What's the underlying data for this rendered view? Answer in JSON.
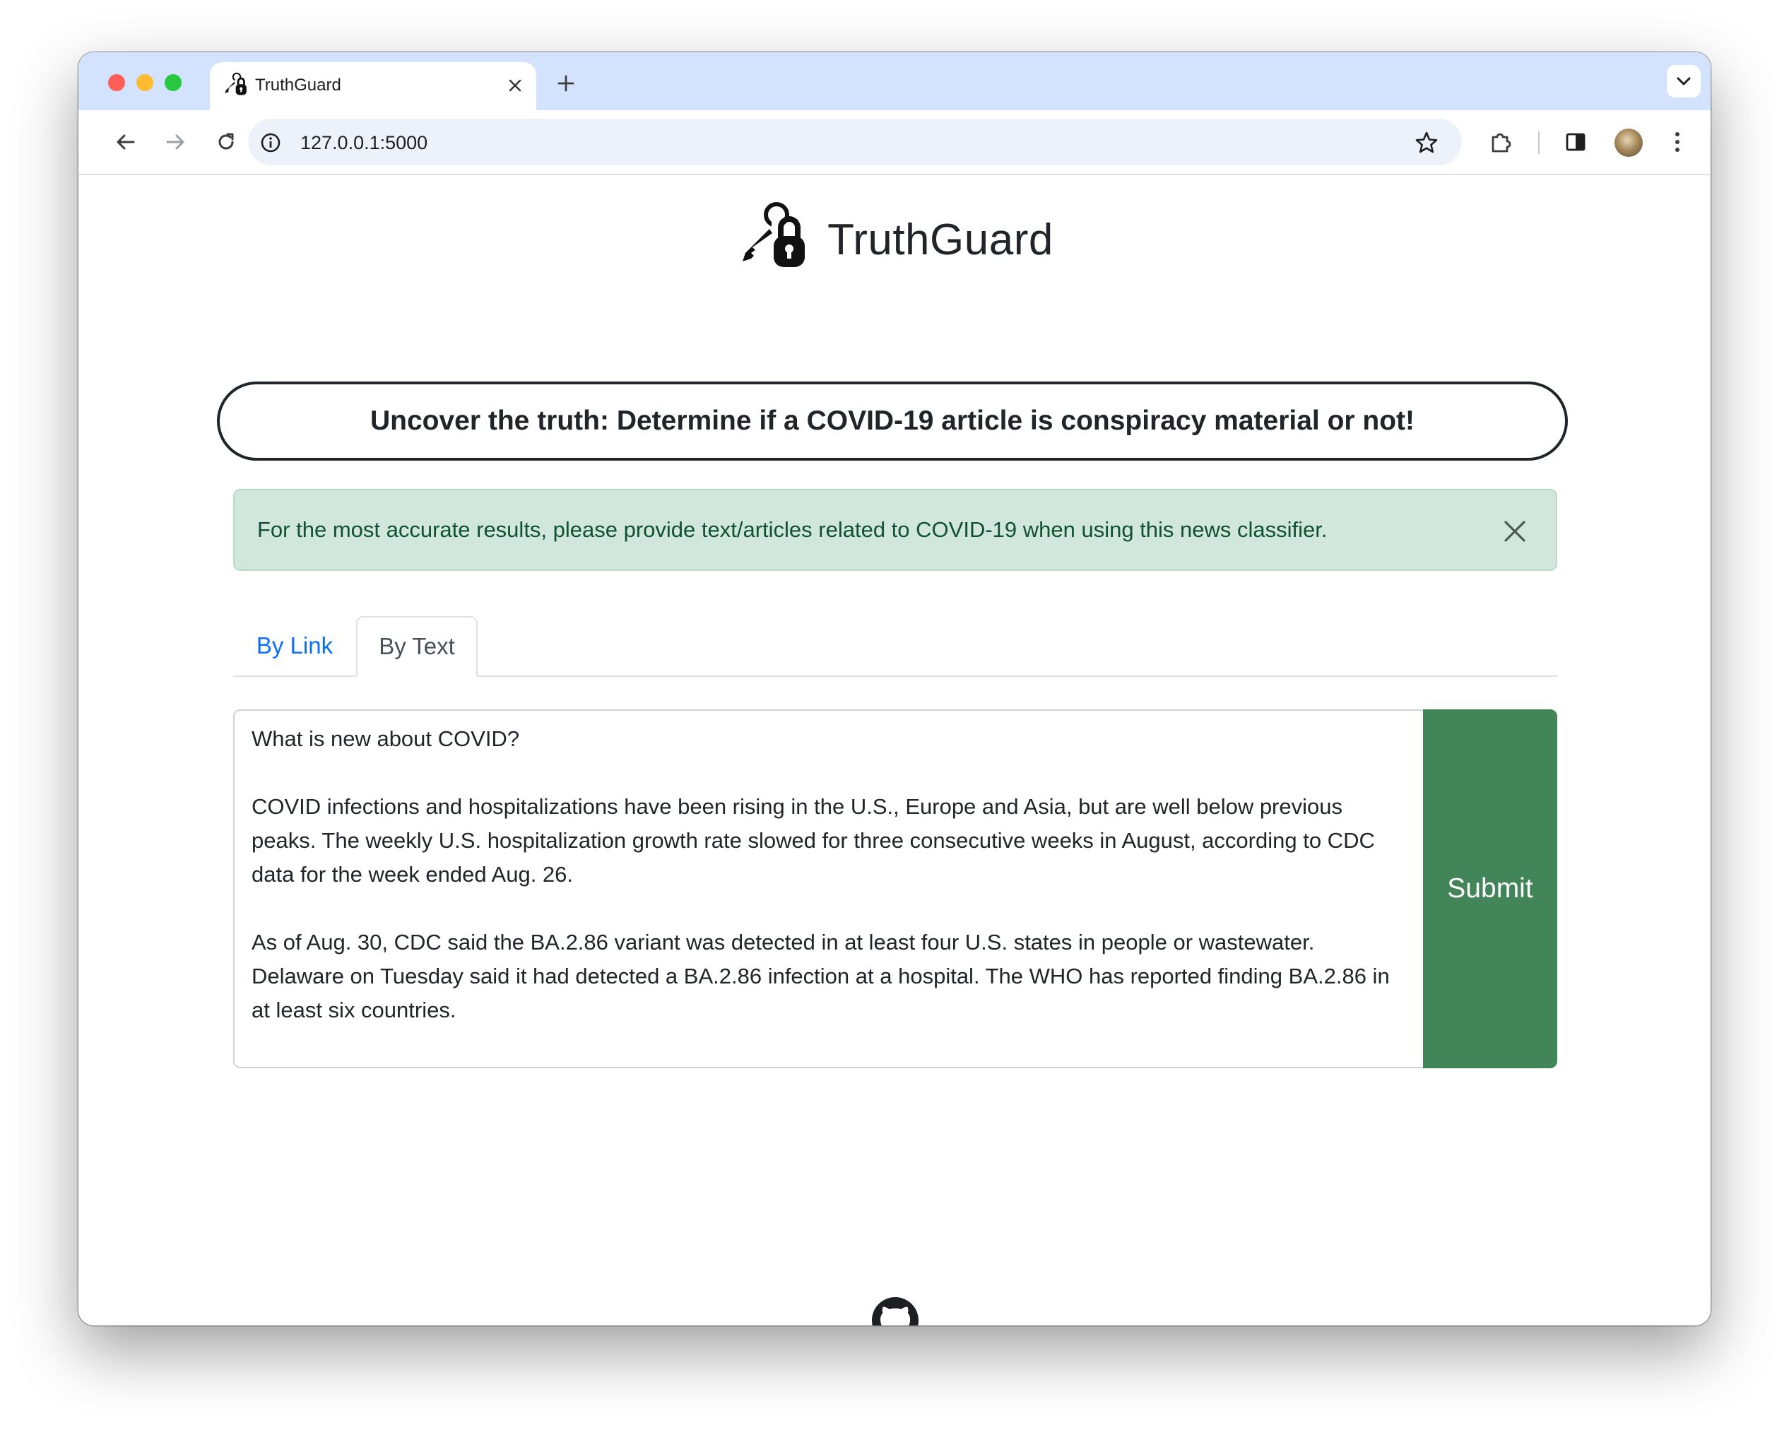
{
  "browser": {
    "tab_title": "TruthGuard",
    "url": "127.0.0.1:5000",
    "icons": [
      "close-icon",
      "plus-icon",
      "chevron-down-icon",
      "back-arrow-icon",
      "forward-arrow-icon",
      "reload-icon",
      "info-icon",
      "star-icon",
      "extensions-icon",
      "side-panel-icon",
      "kebab-menu-icon"
    ]
  },
  "header": {
    "app_name": "TruthGuard",
    "logo_icon": "key-and-lock-icon"
  },
  "tagline": "Uncover the truth: Determine if a COVID-19 article is conspiracy material or not!",
  "alert": {
    "message": "For the most accurate results, please provide text/articles related to COVID-19 when using this news classifier.",
    "color": "#0f5132",
    "background": "#d1e7dd"
  },
  "tabs": {
    "by_link": "By Link",
    "by_text": "By Text",
    "active": "By Text"
  },
  "form": {
    "article_text": "What is new about COVID?\n\nCOVID infections and hospitalizations have been rising in the U.S., Europe and Asia, but are well below previous peaks. The weekly U.S. hospitalization growth rate slowed for three consecutive weeks in August, according to CDC data for the week ended Aug. 26.\n\nAs of Aug. 30, CDC said the BA.2.86 variant was detected in at least four U.S. states in people or wastewater. Delaware on Tuesday said it had detected a BA.2.86 infection at a hospital. The WHO has reported finding BA.2.86 in at least six countries.",
    "submit_label": "Submit",
    "submit_color": "#418559"
  },
  "footer": {
    "icon": "github-icon"
  }
}
